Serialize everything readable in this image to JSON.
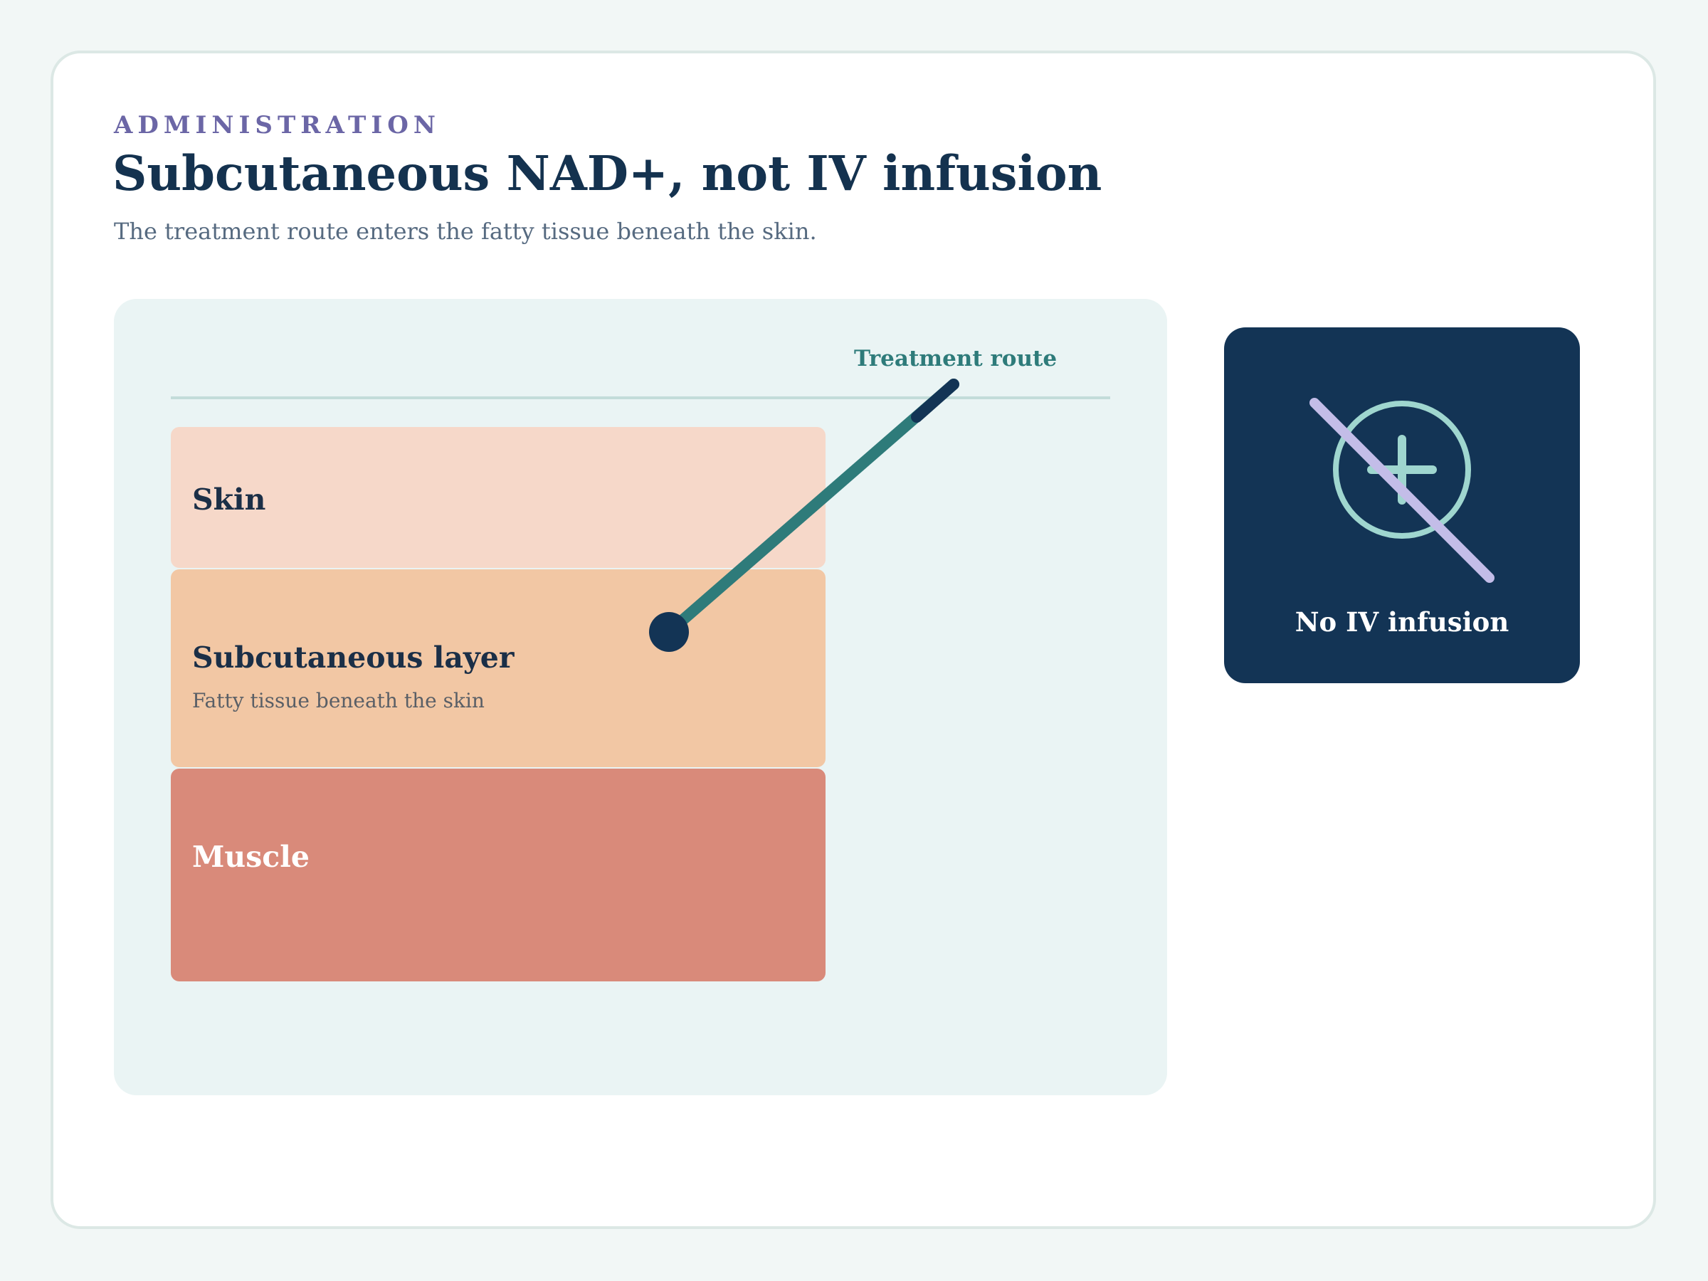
{
  "header": {
    "eyebrow": "ADMINISTRATION",
    "title": "Subcutaneous NAD+, not IV infusion",
    "subtitle": "The treatment route enters the fatty tissue beneath the skin."
  },
  "diagram": {
    "route_label": "Treatment route",
    "layers": [
      {
        "label": "Skin",
        "color": "#f6d8c9"
      },
      {
        "label": "Subcutaneous layer",
        "sublabel": "Fatty tissue beneath the skin",
        "color": "#f2c7a4"
      },
      {
        "label": "Muscle",
        "color": "#d98a7a"
      }
    ],
    "route_color": "#2e7b7a",
    "needle_tip_color": "#133455"
  },
  "iv_card": {
    "label": "No IV infusion",
    "icon": "no-iv-infusion-icon",
    "background": "#133455",
    "circle_color": "#9fd6cf",
    "slash_color": "#c3bde8"
  }
}
